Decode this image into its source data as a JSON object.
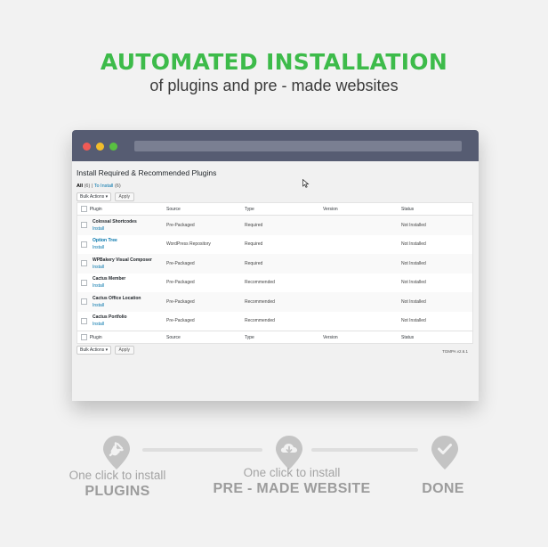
{
  "header": {
    "title": "AUTOMATED INSTALLATION",
    "subtitle": "of plugins and pre - made websites"
  },
  "colors": {
    "accent": "#3dbb4a",
    "titlebar": "#565c72",
    "link": "#0073aa",
    "muted": "#a4a4a4"
  },
  "window": {
    "page_title": "Install Required & Recommended Plugins",
    "filters": {
      "all": "All",
      "all_count": "(6)",
      "separator": "|",
      "to_install": "To Install",
      "to_install_count": "(6)"
    },
    "bulk_actions": "Bulk Actions",
    "apply": "Apply",
    "columns": [
      "Plugin",
      "Source",
      "Type",
      "Version",
      "Status"
    ],
    "plugins": [
      {
        "name": "Colossal Shortcodes",
        "link": "",
        "action": "Install",
        "source": "Pre-Packaged",
        "type": "Required",
        "version": "",
        "status": "Not Installed"
      },
      {
        "name": "",
        "link": "Option Tree",
        "action": "Install",
        "source": "WordPress Repository",
        "type": "Required",
        "version": "",
        "status": "Not Installed"
      },
      {
        "name": "WPBakery Visual Composer",
        "link": "",
        "action": "Install",
        "source": "Pre-Packaged",
        "type": "Required",
        "version": "",
        "status": "Not Installed"
      },
      {
        "name": "Cactus Member",
        "link": "",
        "action": "Install",
        "source": "Pre-Packaged",
        "type": "Recommended",
        "version": "",
        "status": "Not Installed"
      },
      {
        "name": "Cactus Office Location",
        "link": "",
        "action": "Install",
        "source": "Pre-Packaged",
        "type": "Recommended",
        "version": "",
        "status": "Not Installed"
      },
      {
        "name": "Cactus Portfolio",
        "link": "",
        "action": "Install",
        "source": "Pre-Packaged",
        "type": "Recommended",
        "version": "",
        "status": "Not Installed"
      }
    ],
    "version_tag": "TGMPA v2.6.1"
  },
  "steps": [
    {
      "small": "One click to install",
      "big": "PLUGINS",
      "icon": "plug-icon"
    },
    {
      "small": "One click to install",
      "big": "PRE - MADE WEBSITE",
      "icon": "cloud-download-icon"
    },
    {
      "small": "",
      "big": "DONE",
      "icon": "checkmark-icon"
    }
  ]
}
